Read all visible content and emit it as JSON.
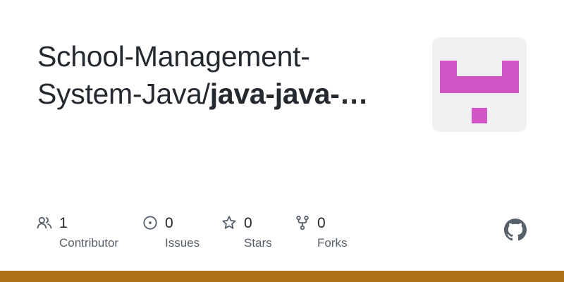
{
  "repo": {
    "owner_line1": "School-Management-",
    "owner_line2": "System-Java/",
    "name_truncated": "java-java-…"
  },
  "stats": [
    {
      "icon": "people-icon",
      "count": "1",
      "label": "Contributor"
    },
    {
      "icon": "issue-icon",
      "count": "0",
      "label": "Issues"
    },
    {
      "icon": "star-icon",
      "count": "0",
      "label": "Stars"
    },
    {
      "icon": "fork-icon",
      "count": "0",
      "label": "Forks"
    }
  ],
  "colors": {
    "language_bar": "#b07219",
    "avatar_pattern": "#d255c6",
    "avatar_bg": "#f0f0f0"
  }
}
